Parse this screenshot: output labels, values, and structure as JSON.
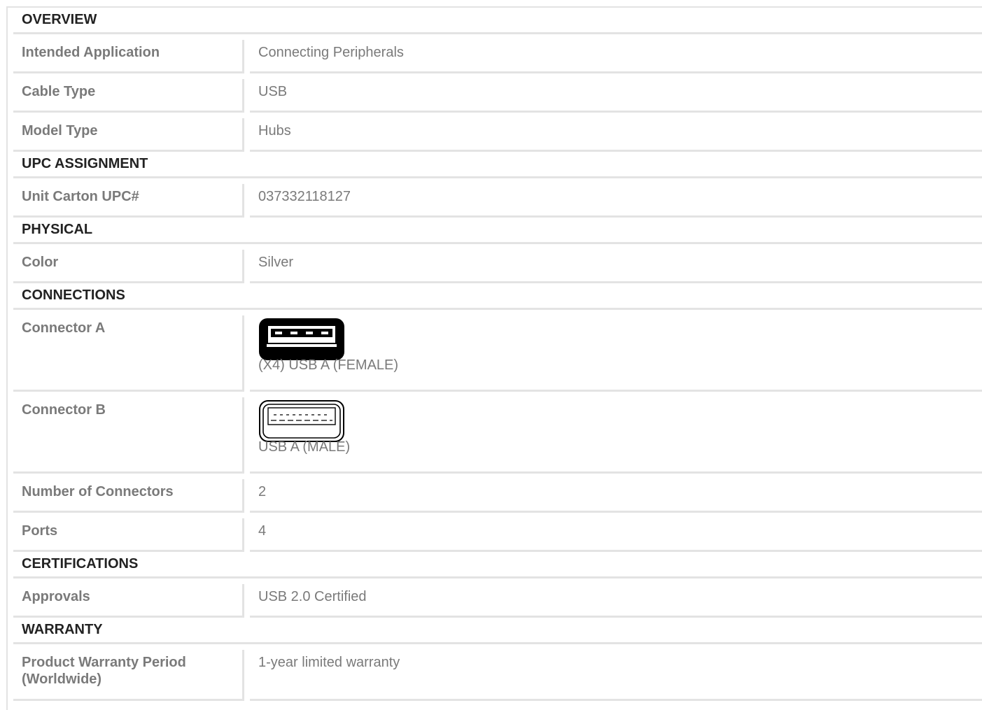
{
  "sections": {
    "overview": {
      "title": "OVERVIEW",
      "rows": [
        {
          "label": "Intended Application",
          "value": "Connecting Peripherals"
        },
        {
          "label": "Cable Type",
          "value": "USB"
        },
        {
          "label": "Model Type",
          "value": "Hubs"
        }
      ]
    },
    "upc": {
      "title": "UPC ASSIGNMENT",
      "rows": [
        {
          "label": "Unit Carton UPC#",
          "value": "037332118127"
        }
      ]
    },
    "physical": {
      "title": "PHYSICAL",
      "rows": [
        {
          "label": "Color",
          "value": "Silver"
        }
      ]
    },
    "connections": {
      "title": "CONNECTIONS",
      "connector_a": {
        "label": "Connector A",
        "caption": "(X4) USB A (FEMALE)",
        "icon": "usb-a-female-icon"
      },
      "connector_b": {
        "label": "Connector B",
        "caption": "USB A (MALE)",
        "icon": "usb-a-male-icon"
      },
      "rows": [
        {
          "label": "Number of Connectors",
          "value": "2"
        },
        {
          "label": "Ports",
          "value": "4"
        }
      ]
    },
    "certifications": {
      "title": "CERTIFICATIONS",
      "rows": [
        {
          "label": "Approvals",
          "value": "USB 2.0 Certified"
        }
      ]
    },
    "warranty": {
      "title": "WARRANTY",
      "rows": [
        {
          "label": "Product Warranty Period (Worldwide)",
          "value": "1-year limited warranty"
        }
      ]
    }
  },
  "colors": {
    "border": "#e3e3e3",
    "label_text": "#7a7a7a",
    "section_text": "#222222"
  }
}
